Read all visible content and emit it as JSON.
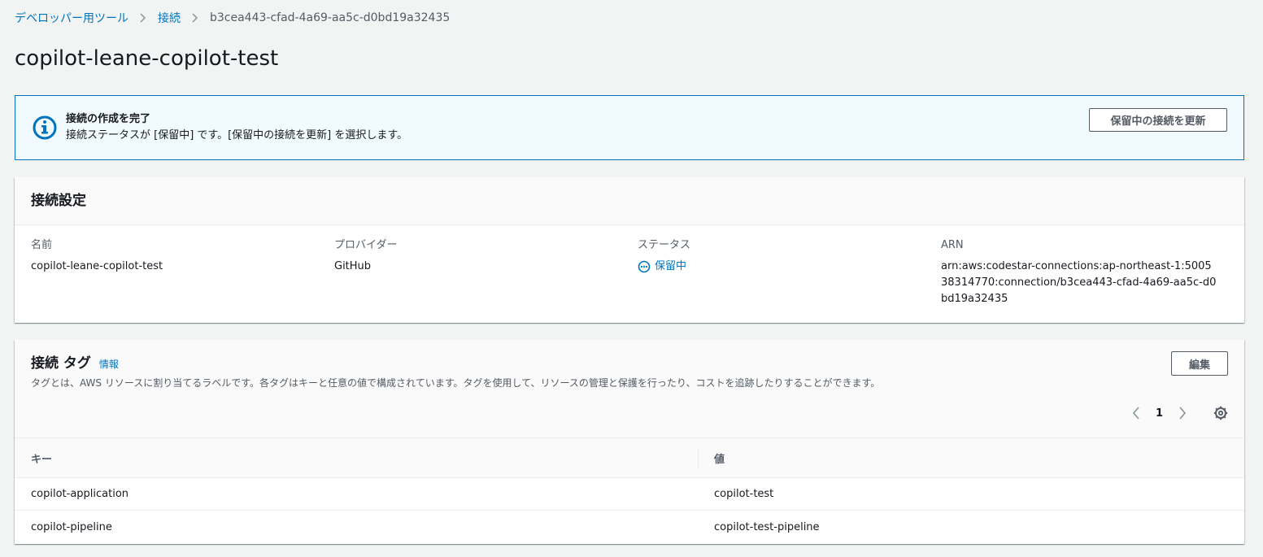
{
  "breadcrumb": {
    "items": [
      "デベロッパー用ツール",
      "接続"
    ],
    "current": "b3cea443-cfad-4a69-aa5c-d0bd19a32435"
  },
  "page": {
    "title": "copilot-leane-copilot-test"
  },
  "flash": {
    "title": "接続の作成を完了",
    "message": "接続ステータスが [保留中] です。[保留中の接続を更新] を選択します。",
    "button_label": "保留中の接続を更新",
    "icon": "info-icon"
  },
  "settings": {
    "title": "接続設定",
    "fields": [
      {
        "label": "名前",
        "value": "copilot-leane-copilot-test"
      },
      {
        "label": "プロバイダー",
        "value": "GitHub"
      },
      {
        "label": "ステータス",
        "value": "保留中"
      },
      {
        "label": "ARN",
        "value": "arn:aws:codestar-connections:ap-northeast-1:500538314770:connection/b3cea443-cfad-4a69-aa5c-d0bd19a32435"
      }
    ]
  },
  "tags": {
    "title": "接続 タグ",
    "info_link": "情報",
    "description": "タグとは、AWS リソースに割り当てるラベルです。各タグはキーと任意の値で構成されています。タグを使用して、リソースの管理と保護を行ったり、コストを追跡したりすることができます。",
    "edit_label": "編集",
    "pagination": {
      "current_page": "1"
    },
    "columns": [
      "キー",
      "値"
    ],
    "rows": [
      {
        "key": "copilot-application",
        "value": "copilot-test"
      },
      {
        "key": "copilot-pipeline",
        "value": "copilot-test-pipeline"
      }
    ]
  },
  "colors": {
    "link": "#0073bb",
    "info_bg": "#f1faff",
    "info_border": "#0073bb",
    "page_bg": "#f2f3f3"
  }
}
